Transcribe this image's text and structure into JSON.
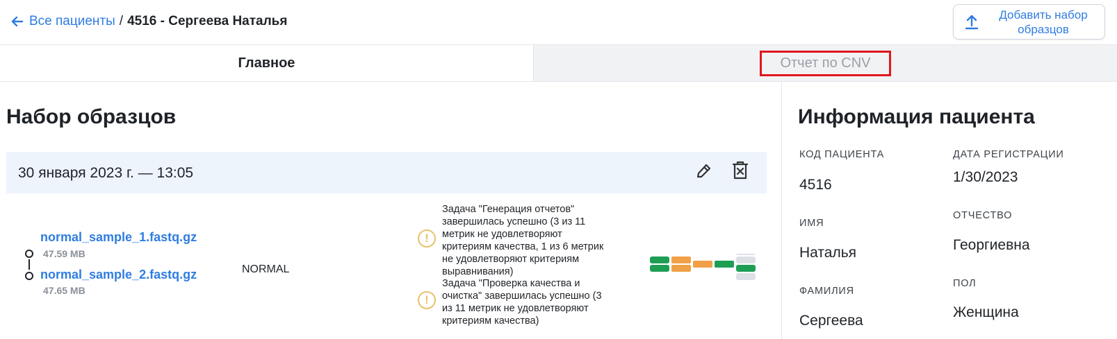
{
  "breadcrumb": {
    "back_label": "Все пациенты",
    "separator": "/",
    "current": "4516 - Сергеева Наталья"
  },
  "add_button": {
    "label": "Добавить набор образцов",
    "icon": "upload-icon"
  },
  "tabs": [
    {
      "label": "Главное",
      "active": true
    },
    {
      "label": "Отчет по CNV",
      "active": false,
      "highlighted": true,
      "highlight_color": "#e0161b"
    }
  ],
  "main": {
    "title": "Набор образцов",
    "sample_set": {
      "date": "30 января 2023 г. — 13:05",
      "files": [
        {
          "name": "normal_sample_1.fastq.gz",
          "size": "47.59 MB"
        },
        {
          "name": "normal_sample_2.fastq.gz",
          "size": "47.65 MB"
        }
      ],
      "sample_type": "NORMAL",
      "tasks": [
        {
          "icon": "warning-icon",
          "text_lines": [
            "Задача \"Генерация отчетов\"",
            "завершилась успешно (3 из 11",
            "метрик не удовлетворяют",
            "критериям качества, 1 из 6 метрик",
            "не удовлетворяют критериям",
            "выравнивания)"
          ]
        },
        {
          "icon": "warning-icon",
          "text_lines": [
            "Задача \"Проверка качества и",
            "очистка\" завершилась успешно (3",
            "из 11 метрик не удовлетворяют",
            "критериям качества)"
          ]
        }
      ],
      "qc_colors": {
        "green": "#1e9e55",
        "orange": "#f0a047",
        "gray": "#dde1e7"
      }
    }
  },
  "patient": {
    "title": "Информация пациента",
    "fields": [
      {
        "label": "КОД ПАЦИЕНТА",
        "value": "4516"
      },
      {
        "label": "ДАТА РЕГИСТРАЦИИ",
        "value": "1/30/2023"
      },
      {
        "label": "ИМЯ",
        "value": "Наталья"
      },
      {
        "label": "ОТЧЕСТВО",
        "value": "Георгиевна"
      },
      {
        "label": "ФАМИЛИЯ",
        "value": "Сергеева"
      },
      {
        "label": "ПОЛ",
        "value": "Женщина"
      }
    ]
  },
  "colors": {
    "accent": "#2f7de1",
    "warning": "#e6c36a",
    "set_header_bg": "#eef4fc"
  }
}
